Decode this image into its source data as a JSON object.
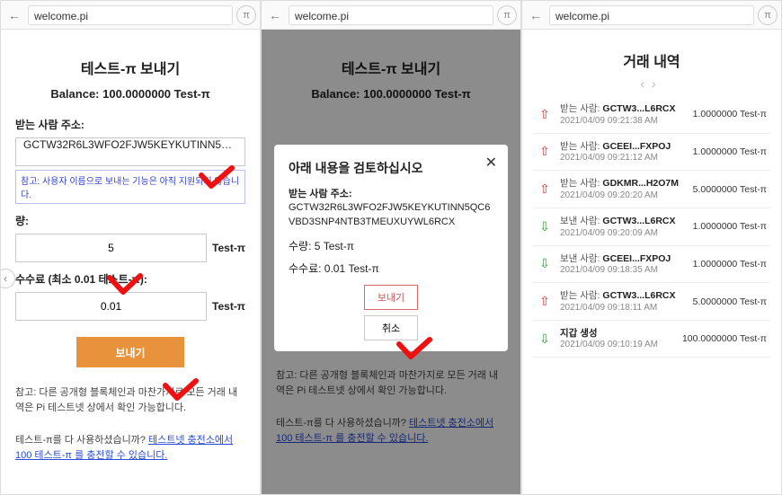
{
  "url": "welcome.pi",
  "pi_icon": "π",
  "pane1": {
    "title": "테스트-π 보내기",
    "balance": "Balance: 100.0000000 Test-π",
    "recipient_label": "받는 사람 주소:",
    "recipient_value": "GCTW32R6L3WFO2FJW5KEYKUTINN5QC...",
    "recipient_hint": "참고: 사용자 이름으로 보내는 기능은 아직 지원되지 않습니다.",
    "amount_label": "량:",
    "amount_value": "5",
    "unit": "Test-π",
    "fee_label": "수수료 (최소 0.01 테스트-π):",
    "fee_value": "0.01",
    "send_label": "보내기",
    "note": "참고: 다른 공개형 블록체인과 마찬가지로 모든 거래 내역은 Pi 테스트넷 상에서 확인 가능합니다.",
    "refill_q": "테스트-π를 다 사용하셨습니까? ",
    "refill_link": "테스트넷 충전소에서 100 테스트-π 를 충전할 수 있습니다."
  },
  "pane2": {
    "title": "테스트-π 보내기",
    "balance": "Balance: 100.0000000 Test-π",
    "modal_title": "아래 내용을 검토하십시오",
    "addr_label": "받는 사람 주소:",
    "addr_value": "GCTW32R6L3WFO2FJW5KEYKUTINN5QC6VBD3SNP4NTB3TMEUXUYWL6RCX",
    "qty_line": "수량: 5 Test-π",
    "fee_line": "수수료: 0.01 Test-π",
    "confirm_label": "보내기",
    "cancel_label": "취소",
    "note": "참고: 다른 공개형 블록체인과 마찬가지로 모든 거래 내역은 Pi 테스트넷 상에서 확인 가능합니다.",
    "refill_q": "테스트-π를 다 사용하셨습니까? ",
    "refill_link": "테스트넷 충전소에서 100 테스트-π 를 충전할 수 있습니다."
  },
  "pane3": {
    "title": "거래 내역",
    "txs": [
      {
        "dir": "out",
        "who_prefix": "받는 사람:",
        "who": "GCTW3...L6RCX",
        "ts": "2021/04/09 09:21:38 AM",
        "amt": "1.0000000 Test-π"
      },
      {
        "dir": "out",
        "who_prefix": "받는 사람:",
        "who": "GCEEI...FXPOJ",
        "ts": "2021/04/09 09:21:12 AM",
        "amt": "1.0000000 Test-π"
      },
      {
        "dir": "out",
        "who_prefix": "받는 사람:",
        "who": "GDKMR...H2O7M",
        "ts": "2021/04/09 09:20:20 AM",
        "amt": "5.0000000 Test-π"
      },
      {
        "dir": "in",
        "who_prefix": "보낸 사람:",
        "who": "GCTW3...L6RCX",
        "ts": "2021/04/09 09:20:09 AM",
        "amt": "1.0000000 Test-π"
      },
      {
        "dir": "in",
        "who_prefix": "보낸 사람:",
        "who": "GCEEI...FXPOJ",
        "ts": "2021/04/09 09:18:35 AM",
        "amt": "1.0000000 Test-π"
      },
      {
        "dir": "out",
        "who_prefix": "받는 사람:",
        "who": "GCTW3...L6RCX",
        "ts": "2021/04/09 09:18:11 AM",
        "amt": "5.0000000 Test-π"
      },
      {
        "dir": "in",
        "who_prefix": "",
        "who": "지갑 생성",
        "ts": "2021/04/09 09:10:19 AM",
        "amt": "100.0000000 Test-π"
      }
    ]
  }
}
